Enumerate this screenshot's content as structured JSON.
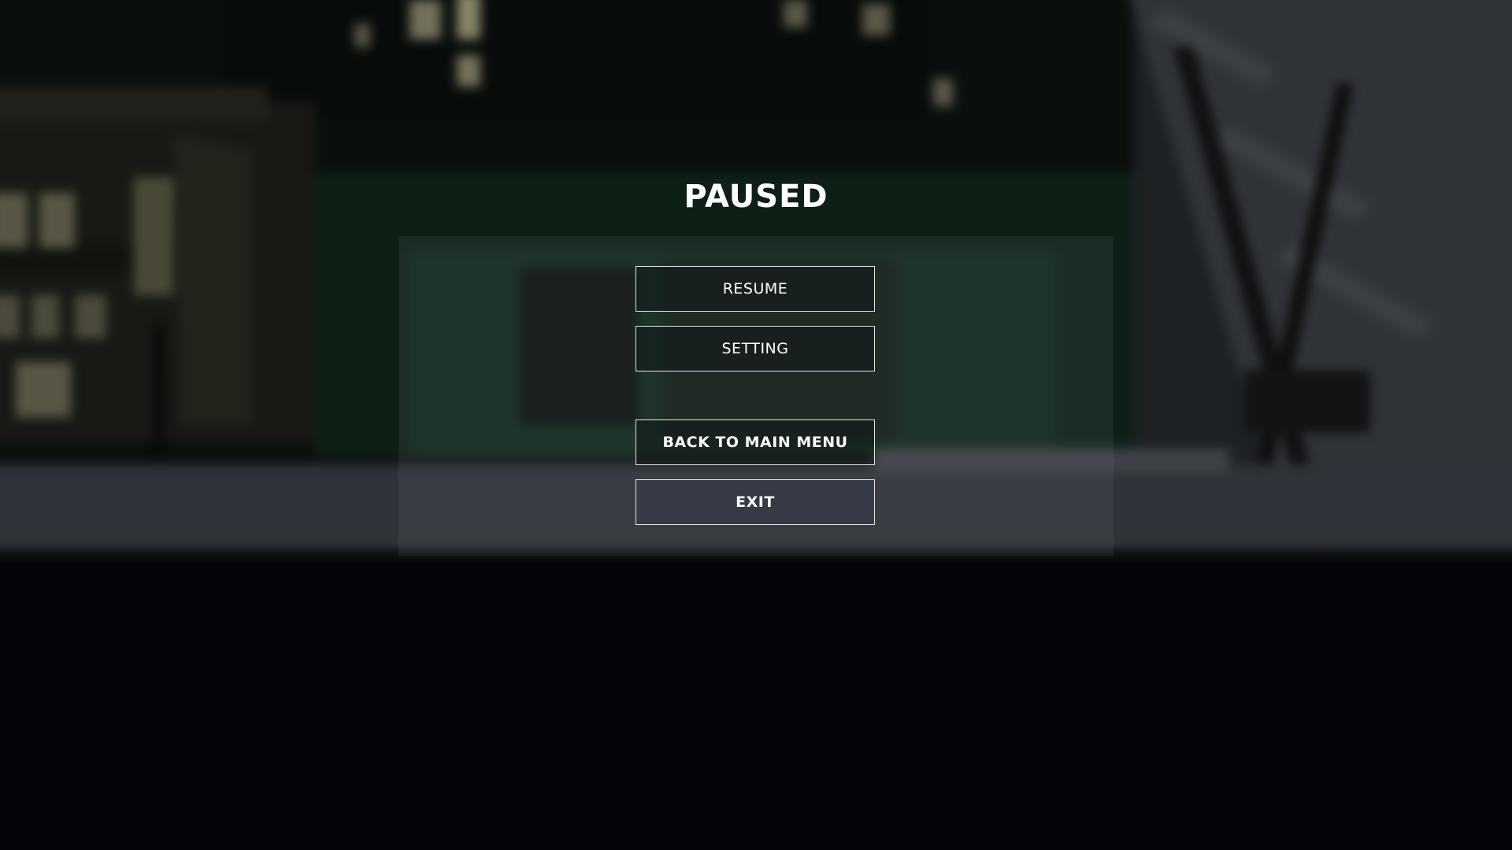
{
  "screen": {
    "title": "PAUSED"
  },
  "menu": {
    "resume_label": "RESUME",
    "setting_label": "SETTING",
    "main_menu_label": "BACK TO MAIN MENU",
    "exit_label": "EXIT"
  },
  "colors": {
    "overlay_bottom": "#04050b",
    "button_border": "#e6e6e6",
    "text": "#ffffff",
    "exit_button_fill": "#343a46"
  }
}
